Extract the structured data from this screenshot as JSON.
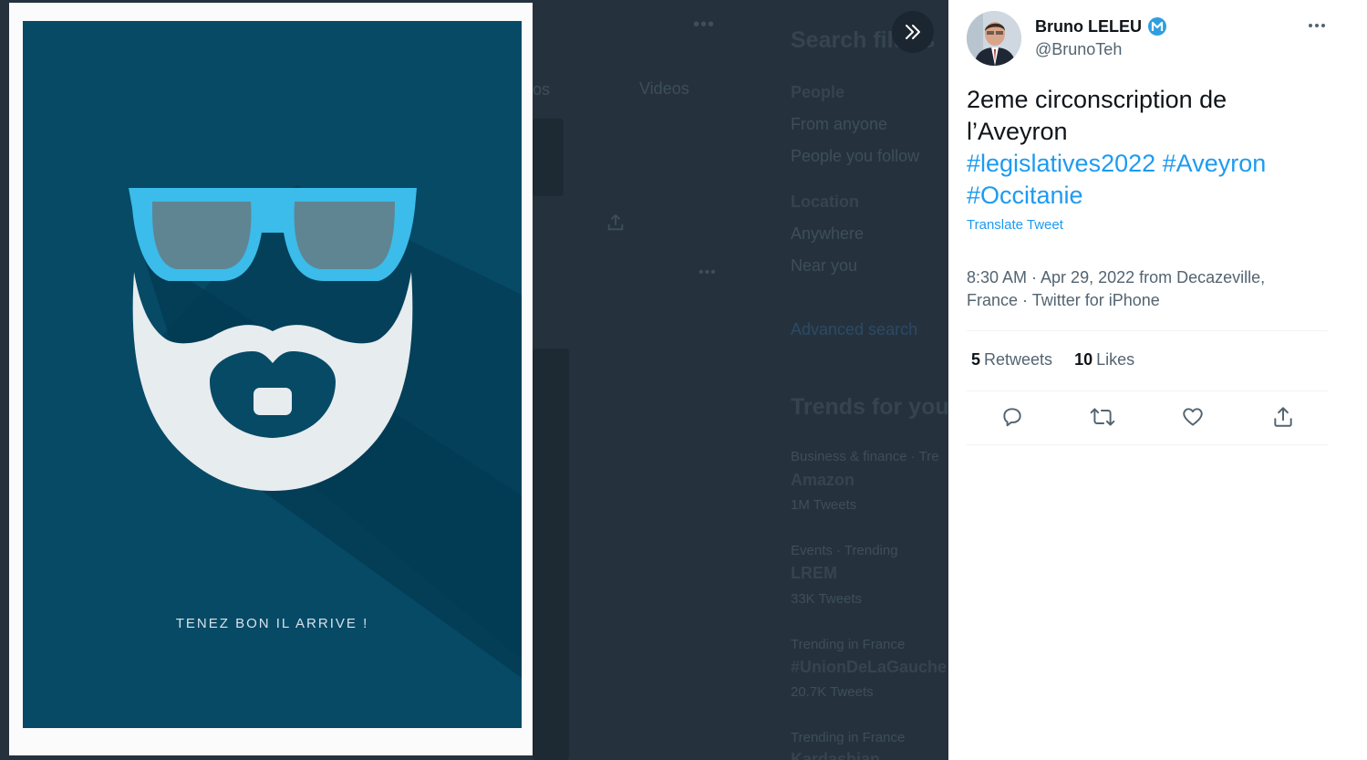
{
  "background": {
    "search_filters_title": "Search filters",
    "tab_videos": "Videos",
    "tab_photos_partial": "os",
    "people_label": "People",
    "from_anyone": "From anyone",
    "people_you_follow": "People you follow",
    "location_label": "Location",
    "anywhere": "Anywhere",
    "near_you": "Near you",
    "advanced_search": "Advanced search",
    "trends_title": "Trends for you",
    "trends": [
      {
        "context": "Business & finance · Tre",
        "name": "Amazon",
        "count": "1M Tweets"
      },
      {
        "context": "Events · Trending",
        "name": "LREM",
        "count": "33K Tweets"
      },
      {
        "context": "Trending in France",
        "name": "#UnionDeLaGauche",
        "count": "20.7K Tweets"
      },
      {
        "context": "Trending in France",
        "name": "Kardashian",
        "count": ""
      }
    ]
  },
  "poster": {
    "caption": "TENEZ BON IL ARRIVE !",
    "background_color": "#064a66",
    "glasses_color": "#3bbcea",
    "beard_color": "#e7ecef"
  },
  "tweet": {
    "display_name": "Bruno LELEU",
    "handle": "@BrunoTeh",
    "verified_icon": "party-logo-badge-icon",
    "text_line1": "2eme circonscription de",
    "text_line2": "l’Aveyron",
    "hashtags": [
      "#legislatives2022",
      "#Aveyron",
      "#Occitanie"
    ],
    "translate_label": "Translate Tweet",
    "meta_line1": "8:30 AM · Apr 29, 2022 from Decazeville,",
    "meta_line2": "France · Twitter for iPhone",
    "retweets_count": "5",
    "retweets_label": "Retweets",
    "likes_count": "10",
    "likes_label": "Likes",
    "accent_color": "#1d9bf0"
  },
  "icons": {
    "reply": "reply-icon",
    "retweet": "retweet-icon",
    "like": "heart-icon",
    "share": "share-icon",
    "collapse": "double-chevron-right-icon",
    "more": "more-icon"
  }
}
